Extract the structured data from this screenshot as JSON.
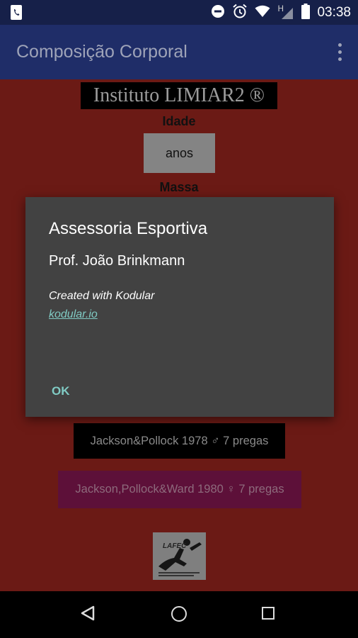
{
  "status_bar": {
    "time": "03:38",
    "network_label": "H",
    "icons": [
      "phone-notification-icon",
      "do-not-disturb-icon",
      "alarm-icon",
      "wifi-icon",
      "signal-icon",
      "battery-icon"
    ]
  },
  "app_bar": {
    "title": "Composição Corporal",
    "overflow_icon": "more-vert-icon"
  },
  "main": {
    "brand": "Instituto LIMIAR2 ®",
    "idade_label": "Idade",
    "anos_value": "anos",
    "massa_label": "Massa",
    "button_jackson_pollock": "Jackson&Pollock 1978 ♂ 7 pregas",
    "button_jackson_pollock_ward": "Jackson,Pollock&Ward 1980 ♀ 7 pregas",
    "logo_text": "LAFEC"
  },
  "dialog": {
    "title": "Assessoria Esportiva",
    "subtitle": "Prof. João Brinkmann",
    "created_text": "Created with Kodular",
    "link_text": "kodular.io",
    "ok_label": "OK"
  },
  "nav_bar": {
    "icons": [
      "back-icon",
      "home-icon",
      "recents-icon"
    ]
  },
  "colors": {
    "status_bar": "#162049",
    "app_bar": "#1f2d68",
    "background": "#6b1a15",
    "dialog": "#424242",
    "accent": "#80cbc4",
    "pink_button": "#5d1039"
  }
}
